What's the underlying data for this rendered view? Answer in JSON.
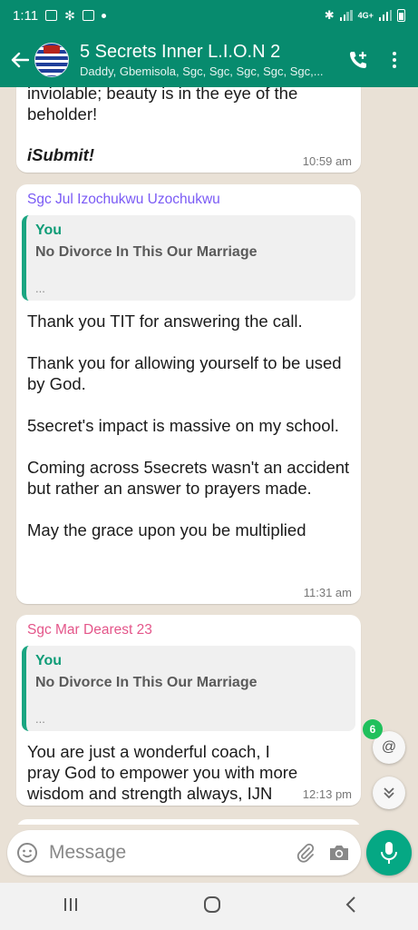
{
  "status_bar": {
    "time": "1:11",
    "network": "4G+"
  },
  "header": {
    "title": "5 Secrets Inner L.I.O.N 2",
    "subtitle": "Daddy, Gbemisola, Sgc, Sgc, Sgc, Sgc, Sgc,..."
  },
  "messages": [
    {
      "text": "inviolable; beauty is in the eye of the beholder!",
      "text2": "iSubmit!",
      "time": "10:59 am"
    },
    {
      "sender": "Sgc Jul Izochukwu Uzochukwu",
      "sender_color": "#7a5af5",
      "quote_author": "You",
      "quote_text": "No Divorce In This Our Marriage",
      "quote_ellipsis": "...",
      "text": "Thank you TIT for answering the call.\n\nThank you for allowing yourself to be used by God.\n\n5secret's impact is massive on my school.\n\nComing across 5secrets wasn't an accident but rather an answer to prayers made.\n\nMay the grace upon you be multiplied",
      "time": "11:31 am"
    },
    {
      "sender": "Sgc Mar Dearest 23",
      "sender_color": "#e4568a",
      "quote_author": "You",
      "quote_text": "No Divorce In This Our Marriage",
      "quote_ellipsis": "...",
      "text": "You are just a wonderful coach, I pray God to empower you with more wisdom and strength always, IJN",
      "time": "12:13 pm"
    }
  ],
  "floating": {
    "unread_mentions": "6",
    "mention_symbol": "@"
  },
  "composer": {
    "placeholder": "Message"
  },
  "colors": {
    "header": "#078b6e",
    "accent": "#05a884",
    "chat_background": "#e9e1d6"
  },
  "icons": [
    "back-arrow-icon",
    "group-avatar",
    "add-call-icon",
    "more-options-icon",
    "emoji-icon",
    "attach-icon",
    "camera-icon",
    "mic-icon",
    "scroll-down-icon"
  ]
}
